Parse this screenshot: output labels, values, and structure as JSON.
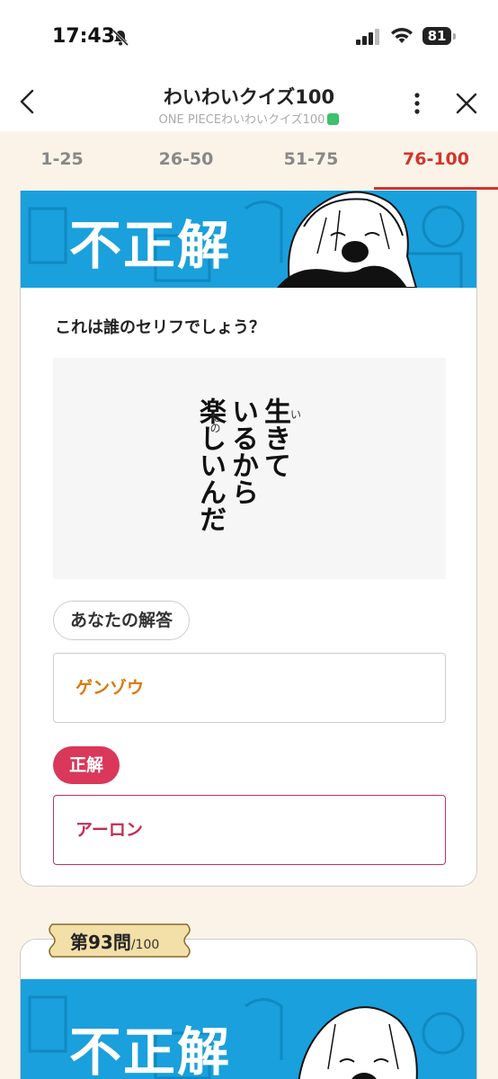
{
  "status_bar": {
    "time": "17:43",
    "battery": "81"
  },
  "header": {
    "title": "わいわいクイズ100",
    "subtitle": "ONE PIECEわいわいクイズ100"
  },
  "tabs": [
    {
      "label": "1-25",
      "active": false
    },
    {
      "label": "26-50",
      "active": false
    },
    {
      "label": "51-75",
      "active": false
    },
    {
      "label": "76-100",
      "active": true
    }
  ],
  "result_card": {
    "banner_text": "不正解",
    "question": "これは誰のセリフでしょう？",
    "quote_lines": [
      "生きて",
      "いるから",
      "楽しいんだ"
    ],
    "ruby": {
      "iki": "い",
      "tano": "たの"
    },
    "your_answer_label": "あなたの解答",
    "your_answer": "ゲンゾウ",
    "correct_label": "正解",
    "correct_answer": "アーロン"
  },
  "next_card": {
    "question_number": "第93問",
    "question_total": "/100",
    "banner_text": "不正解"
  },
  "colors": {
    "accent": "#d3342c",
    "banner_blue": "#1aa0dc",
    "your_answer": "#d9780a",
    "correct": "#d9385a",
    "background": "#fcf3e8"
  }
}
